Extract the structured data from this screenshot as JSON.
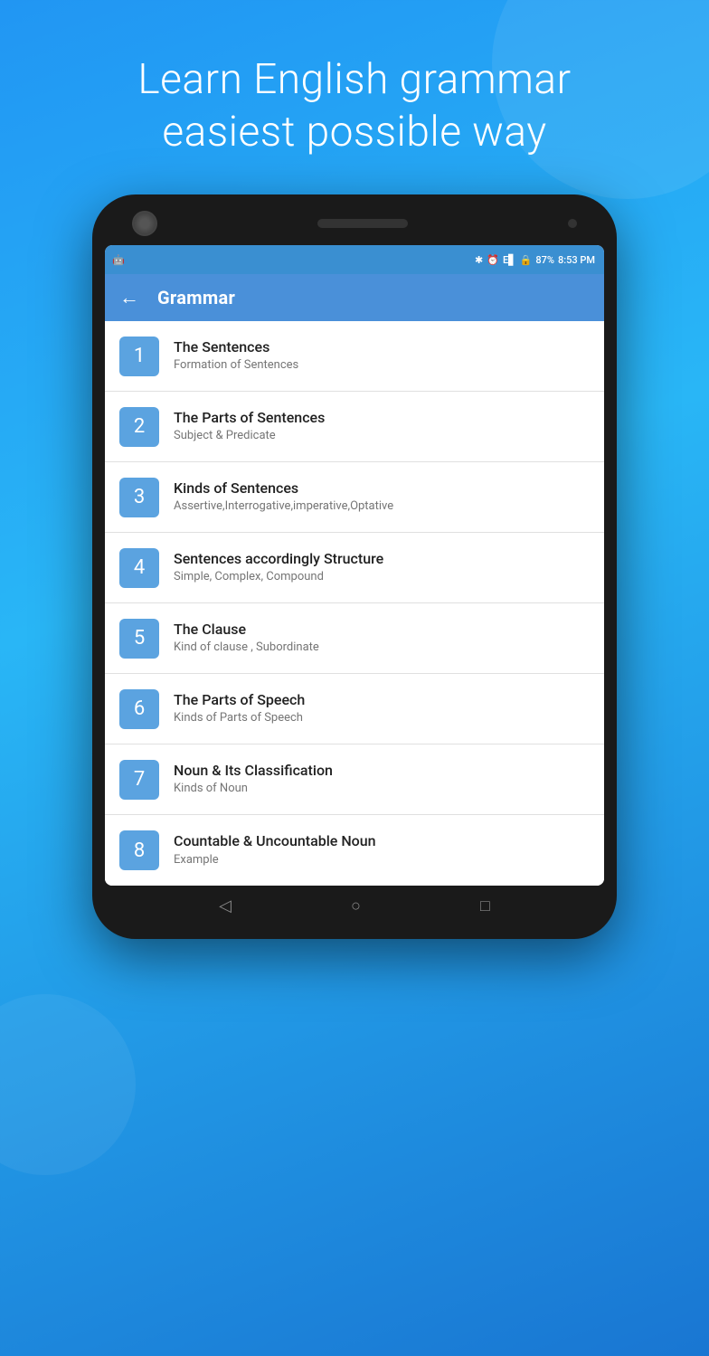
{
  "hero": {
    "line1": "Learn English grammar",
    "line2": "easiest possible way"
  },
  "status_bar": {
    "battery_percent": "87%",
    "time": "8:53 PM"
  },
  "app_bar": {
    "back_label": "←",
    "title": "Grammar"
  },
  "list_items": [
    {
      "number": "1",
      "title": "The Sentences",
      "subtitle": "Formation of Sentences"
    },
    {
      "number": "2",
      "title": "The Parts of Sentences",
      "subtitle": "Subject & Predicate"
    },
    {
      "number": "3",
      "title": "Kinds of Sentences",
      "subtitle": "Assertive,Interrogative,imperative,Optative"
    },
    {
      "number": "4",
      "title": "Sentences accordingly Structure",
      "subtitle": "Simple, Complex, Compound"
    },
    {
      "number": "5",
      "title": "The Clause",
      "subtitle": "Kind of clause , Subordinate"
    },
    {
      "number": "6",
      "title": "The Parts of Speech",
      "subtitle": "Kinds of Parts of Speech"
    },
    {
      "number": "7",
      "title": "Noun & Its Classification",
      "subtitle": "Kinds of Noun"
    },
    {
      "number": "8",
      "title": "Countable & Uncountable Noun",
      "subtitle": "Example"
    }
  ]
}
